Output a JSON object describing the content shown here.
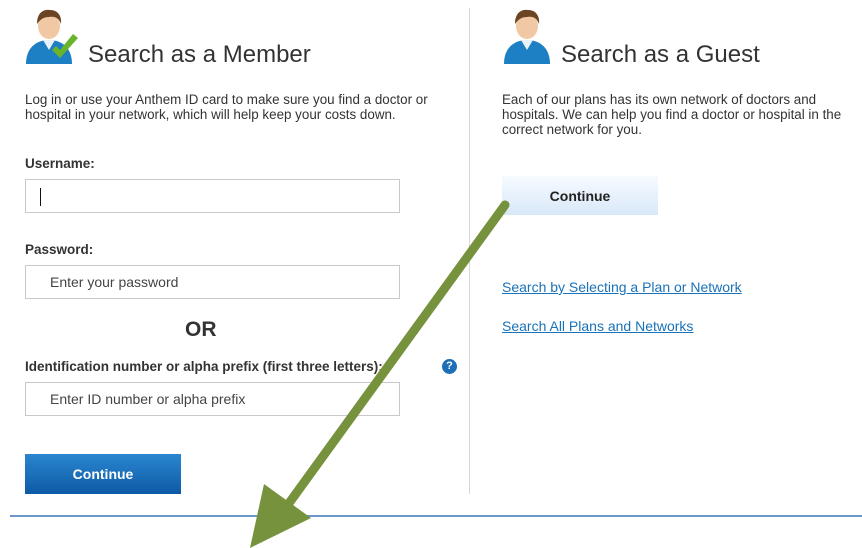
{
  "member": {
    "title": "Search as a Member",
    "description": "Log in or use your Anthem ID card to make sure you find a doctor or hospital in your network, which will help keep your costs down.",
    "username_label": "Username:",
    "username_value": "",
    "password_label": "Password:",
    "password_placeholder": "Enter your password",
    "or_text": "OR",
    "id_label": "Identification number or alpha prefix (first three letters):",
    "id_placeholder": "Enter ID number or alpha prefix",
    "help_icon": "?",
    "continue_label": "Continue"
  },
  "guest": {
    "title": "Search as a Guest",
    "description": "Each of our plans has its own network of doctors and hospitals. We can help you find a doctor or hospital in the correct network for you.",
    "continue_label": "Continue",
    "links": [
      {
        "label": "Search by Selecting a Plan or Network"
      },
      {
        "label": "Search All Plans and Networks"
      }
    ]
  },
  "colors": {
    "primary_button": "#0d5aa5",
    "link": "#1a72b8",
    "arrow": "#76923c",
    "check": "#6ab42d",
    "avatar_shirt": "#1d7fc4"
  }
}
